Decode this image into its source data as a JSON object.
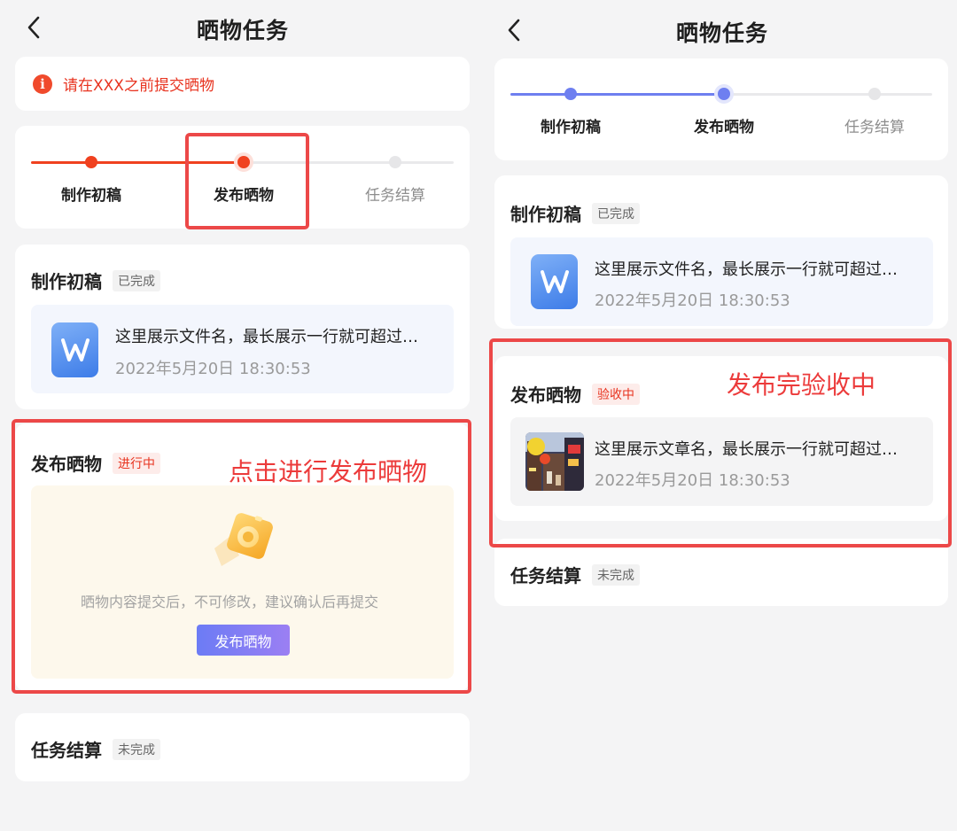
{
  "colors": {
    "accent_red": "#f0411f",
    "accent_blue": "#6e7ff0",
    "highlight_red": "#ec4848",
    "page_bg": "#f4f4f5"
  },
  "left": {
    "title": "晒物任务",
    "back_icon": "chevron-left-icon",
    "notice": {
      "icon": "info-icon",
      "icon_glyph": "i",
      "text": "请在XXX之前提交晒物"
    },
    "steps": [
      {
        "label": "制作初稿",
        "state": "done"
      },
      {
        "label": "发布晒物",
        "state": "current"
      },
      {
        "label": "任务结算",
        "state": "pending"
      }
    ],
    "draft": {
      "title": "制作初稿",
      "badge": "已完成",
      "file_icon": "word-doc-icon",
      "file_name": "这里展示文件名，最长展示一行就可超过…",
      "file_time": "2022年5月20日 18:30:53"
    },
    "publish": {
      "title": "发布晒物",
      "badge": "进行中",
      "illustration": "camera-upload-icon",
      "hint": "晒物内容提交后，不可修改，建议确认后再提交",
      "button": "发布晒物"
    },
    "settle": {
      "title": "任务结算",
      "badge": "未完成"
    },
    "annotation": "点击进行发布晒物"
  },
  "right": {
    "title": "晒物任务",
    "back_icon": "chevron-left-icon",
    "steps": [
      {
        "label": "制作初稿",
        "state": "done"
      },
      {
        "label": "发布晒物",
        "state": "current"
      },
      {
        "label": "任务结算",
        "state": "pending"
      }
    ],
    "draft": {
      "title": "制作初稿",
      "badge": "已完成",
      "file_icon": "word-doc-icon",
      "file_name": "这里展示文件名，最长展示一行就可超过…",
      "file_time": "2022年5月20日 18:30:53"
    },
    "publish": {
      "title": "发布晒物",
      "badge": "验收中",
      "thumb_icon": "street-photo-thumbnail",
      "file_name": "这里展示文章名，最长展示一行就可超过…",
      "file_time": "2022年5月20日 18:30:53"
    },
    "settle": {
      "title": "任务结算",
      "badge": "未完成"
    },
    "annotation": "发布完验收中"
  }
}
